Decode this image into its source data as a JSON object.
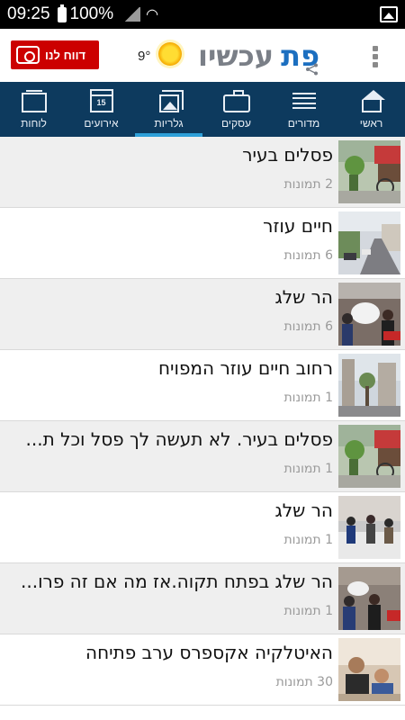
{
  "status_bar": {
    "time": "09:25",
    "battery": "100%"
  },
  "header": {
    "report_label": "דווח לנו",
    "temperature": "9°",
    "logo_part1": "עכשיו",
    "logo_part2": "פת",
    "accent_color": "#1c6fc0",
    "report_color": "#cc0000"
  },
  "nav": {
    "items": [
      {
        "label": "ראשי",
        "icon": "home-icon"
      },
      {
        "label": "מדורים",
        "icon": "list-icon"
      },
      {
        "label": "עסקים",
        "icon": "briefcase-icon"
      },
      {
        "label": "גלריות",
        "icon": "gallery-icon",
        "active": true
      },
      {
        "label": "אירועים",
        "icon": "calendar-icon",
        "calendar_day": "15"
      },
      {
        "label": "לוחות",
        "icon": "board-icon"
      }
    ]
  },
  "galleries": [
    {
      "title": "פסלים בעיר",
      "count": "2 תמונות"
    },
    {
      "title": "חיים עוזר",
      "count": "6 תמונות"
    },
    {
      "title": "הר שלג",
      "count": "6 תמונות"
    },
    {
      "title": "רחוב חיים עוזר המפויח",
      "count": "1 תמונות"
    },
    {
      "title": "פסלים בעיר. לא תעשה לך פסל וכל ת...",
      "count": "1 תמונות"
    },
    {
      "title": "הר שלג",
      "count": "1 תמונות"
    },
    {
      "title": "הר שלג בפתח תקוה.אז מה אם זה פרו...",
      "count": "1 תמונות"
    },
    {
      "title": "האיטלקיה אקספרס ערב פתיחה",
      "count": "30 תמונות"
    }
  ]
}
